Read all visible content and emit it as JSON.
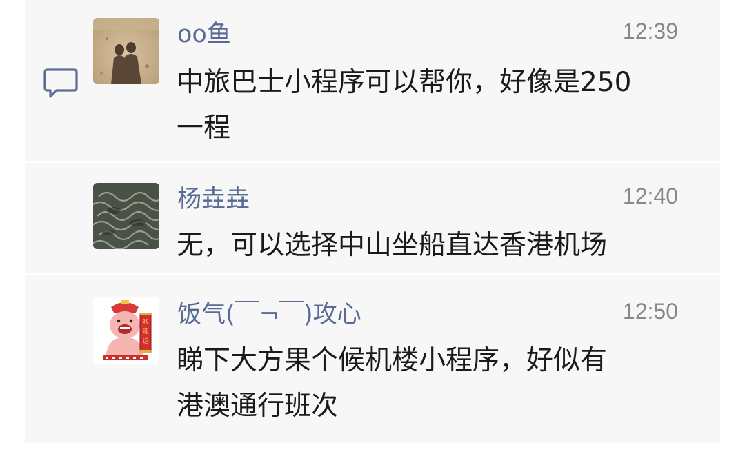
{
  "comments": [
    {
      "name": "oo鱼",
      "time": "12:39",
      "line1": "中旅巴士小程序可以帮你，好像是250",
      "line2": "一程"
    },
    {
      "name": "杨垚垚",
      "time": "12:40",
      "line1": "无，可以选择中山坐船直达香港机场"
    },
    {
      "name": "饭气(￣¬￣)攻心",
      "time": "12:50",
      "line1": "睇下大方果个候机楼小程序，好似有",
      "line2": "港澳通行班次",
      "avatar_banner": "欢迎运"
    }
  ],
  "colors": {
    "name": "#576b95",
    "text": "#1a1a1a",
    "time": "#888888",
    "panel": "#f7f7f7"
  },
  "icons": {
    "comments_section": "comment-bubble-icon"
  }
}
